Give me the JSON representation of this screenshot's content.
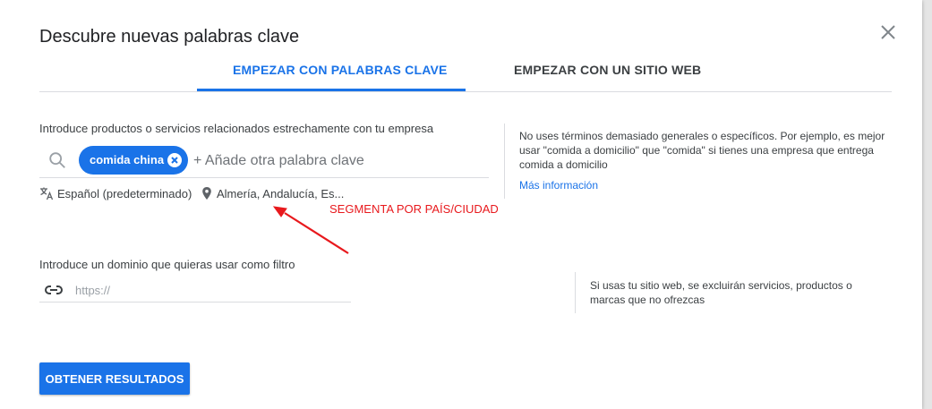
{
  "dialog": {
    "title": "Descubre nuevas palabras clave"
  },
  "tabs": [
    {
      "label": "EMPEZAR CON PALABRAS CLAVE",
      "active": true
    },
    {
      "label": "EMPEZAR CON UN SITIO WEB",
      "active": false
    }
  ],
  "keywords": {
    "label": "Introduce productos o servicios relacionados estrechamente con tu empresa",
    "chips": [
      "comida china"
    ],
    "placeholder": "+ Añade otra palabra clave",
    "language": "Español (predeterminado)",
    "location": "Almería, Andalucía, Es..."
  },
  "help": {
    "keywords_text": "No uses términos demasiado generales o específicos. Por ejemplo, es mejor usar \"comida a domicilio\" que \"comida\" si tienes una empresa que entrega comida a domicilio",
    "more_link": "Más información",
    "domain_text": "Si usas tu sitio web, se excluirán servicios, productos o marcas que no ofrezcas"
  },
  "annotation": {
    "text": "SEGMENTA POR PAÍS/CIUDAD",
    "color": "#e8191d"
  },
  "domain": {
    "label": "Introduce un dominio que quieras usar como filtro",
    "placeholder": "https://"
  },
  "submit": {
    "label": "OBTENER RESULTADOS"
  },
  "colors": {
    "accent": "#1a73e8",
    "text": "#3c4043",
    "divider": "#dadce0"
  },
  "icons": {
    "close": "close-icon",
    "search": "search-icon",
    "chip_remove": "cancel-circle-icon",
    "language": "translate-icon",
    "location": "location-pin-icon",
    "link": "link-icon"
  }
}
